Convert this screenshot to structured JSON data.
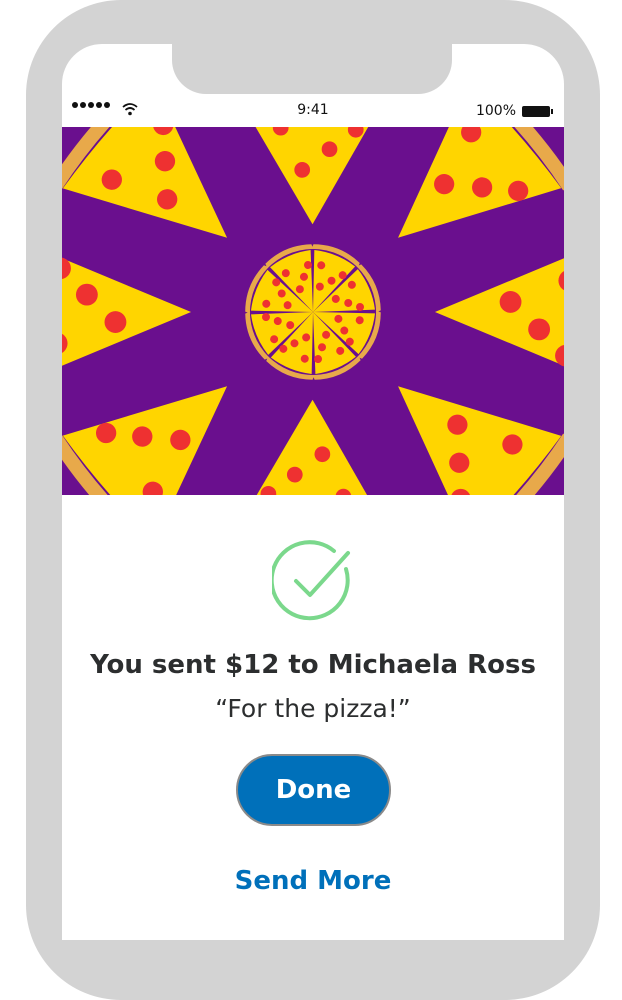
{
  "status_bar": {
    "time": "9:41",
    "battery_percent": "100%",
    "signal_icon": "signal-dots-icon",
    "wifi_icon": "wifi-icon",
    "battery_icon": "battery-icon"
  },
  "hero": {
    "image": "pizza-slices-illustration",
    "colors": {
      "background": "#6a0f8e",
      "cheese": "#ffd500",
      "crust": "#e8a94a",
      "pepperoni": "#ee3131"
    }
  },
  "confirmation": {
    "icon": "checkmark-circle-icon",
    "icon_color": "#7bd88c",
    "title": "You sent $12 to Michaela Ross",
    "note": "“For the pizza!”"
  },
  "actions": {
    "done_label": "Done",
    "send_more_label": "Send More",
    "accent": "#0070ba"
  }
}
